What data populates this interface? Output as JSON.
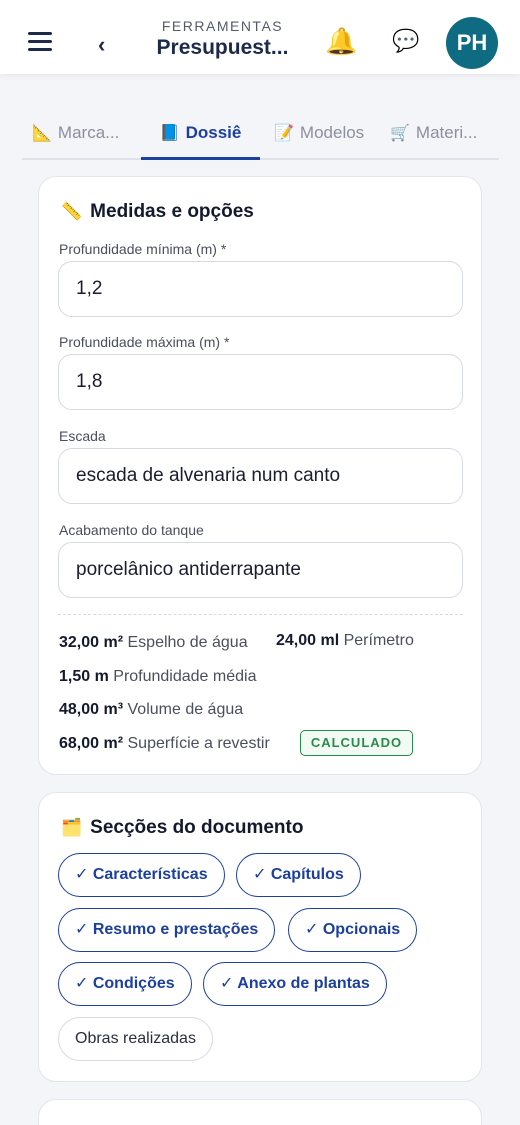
{
  "header": {
    "kicker": "FERRAMENTAS",
    "title": "Presupuest...",
    "avatar_initials": "PH",
    "icons": [
      "menu-icon",
      "back-icon",
      "bell-icon",
      "chat-icon"
    ]
  },
  "tabs": [
    {
      "icon": "📐",
      "label": "Marca..."
    },
    {
      "icon": "📘",
      "label": "Dossiê"
    },
    {
      "icon": "📝",
      "label": "Modelos"
    },
    {
      "icon": "🛒",
      "label": "Materi..."
    }
  ],
  "measures": {
    "title": "Medidas e opções",
    "icon": "📏",
    "fields": [
      {
        "label": "Profundidade mínima (m) *",
        "value": "1,2"
      },
      {
        "label": "Profundidade máxima (m) *",
        "value": "1,8"
      },
      {
        "label": "Escada",
        "value": "escada de alvenaria num canto"
      },
      {
        "label": "Acabamento do tanque",
        "value": "porcelânico antiderrapante"
      }
    ],
    "stats": [
      {
        "value": "32,00 m²",
        "label": "Espelho de água"
      },
      {
        "value": "24,00 ml",
        "label": "Perímetro"
      },
      {
        "value": "1,50 m",
        "label": "Profundidade média"
      },
      {
        "value": "48,00 m³",
        "label": "Volume de água"
      },
      {
        "value": "68,00 m²",
        "label": "Superfície a revestir"
      }
    ],
    "badge": "CALCULADO"
  },
  "sections": {
    "title": "Secções do documento",
    "icon": "🗂️",
    "chips": [
      {
        "label": "✓ Características",
        "selected": true
      },
      {
        "label": "✓ Capítulos",
        "selected": true
      },
      {
        "label": "✓ Resumo e prestações",
        "selected": true
      },
      {
        "label": "✓ Opcionais",
        "selected": true
      },
      {
        "label": "✓ Condições",
        "selected": true
      },
      {
        "label": "✓ Anexo de plantas",
        "selected": true
      },
      {
        "label": "Obras realizadas",
        "selected": false
      }
    ]
  },
  "colors": {
    "accent": "#1d3f9e",
    "avatar_bg": "#0f6b82",
    "success": "#2a8a4c"
  }
}
